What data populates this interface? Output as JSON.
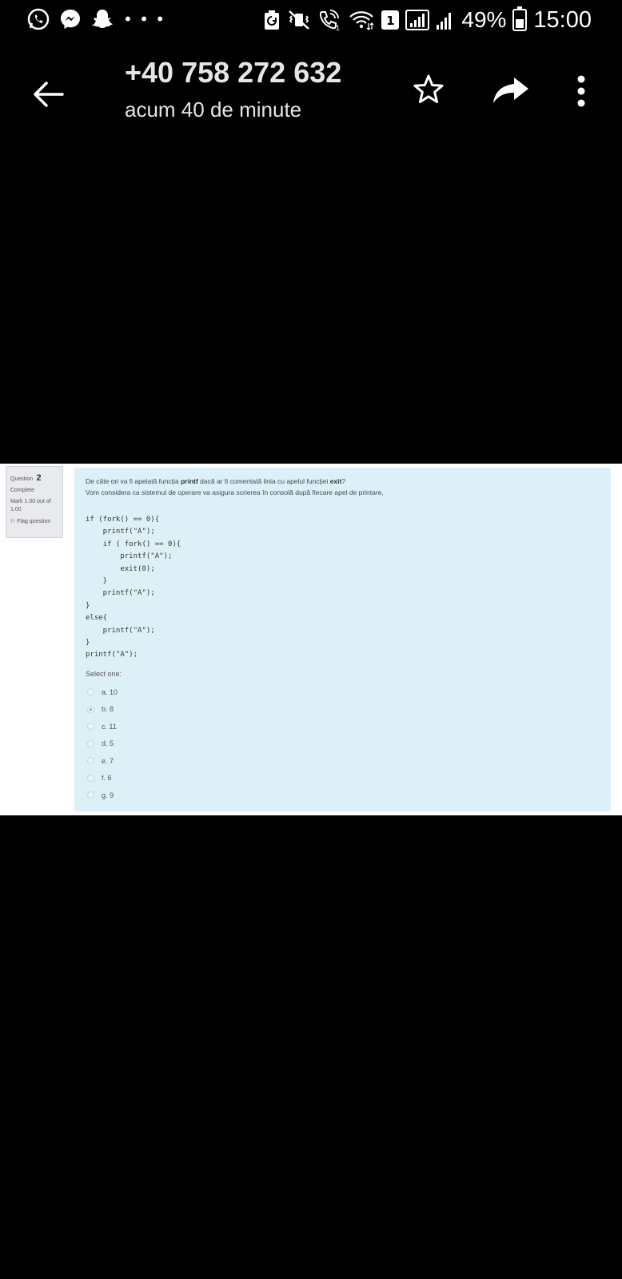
{
  "status_bar": {
    "left_icons": [
      "whatsapp-icon",
      "messenger-icon",
      "snapchat-icon"
    ],
    "more_notifications": "• • •",
    "right_icons": [
      "battery-saver-icon",
      "vibrate-mute-icon",
      "volte-call-icon",
      "wifi-icon",
      "sim-1-icon",
      "signal-icon",
      "signal-2-icon"
    ],
    "sim_label": "1",
    "battery_percent": "49%",
    "time": "15:00"
  },
  "header": {
    "contact": "+40 758 272 632",
    "subtitle": "acum 40 de minute",
    "icons": [
      "back-arrow-icon",
      "star-icon",
      "share-icon",
      "more-vert-icon"
    ]
  },
  "image": {
    "question_label": "Question",
    "question_number": "2",
    "state": "Complete",
    "mark": "Mark 1.00 out of 1.00",
    "flag": "Flag question",
    "question_line1_pre": "De câte ori va fi apelată funcția ",
    "question_line1_bold1": "printf",
    "question_line1_mid": " dacă ar fi comentată linia cu apelul funcției ",
    "question_line1_bold2": "exit",
    "question_line1_post": "?",
    "question_line2": "Vom considera ca sistemul de operare va asigura scrierea în consolă după fiecare apel de printare.",
    "code": "if (fork() == 0){\n    printf(\"A\");\n    if ( fork() == 0){\n        printf(\"A\");\n        exit(0);\n    }\n    printf(\"A\");\n}\nelse{\n    printf(\"A\");\n}\nprintf(\"A\");",
    "select_one": "Select one:",
    "options": [
      {
        "label": "a. 10",
        "checked": false
      },
      {
        "label": "b. 8",
        "checked": true
      },
      {
        "label": "c. 11",
        "checked": false
      },
      {
        "label": "d. 5",
        "checked": false
      },
      {
        "label": "e. 7",
        "checked": false
      },
      {
        "label": "f. 6",
        "checked": false
      },
      {
        "label": "g. 9",
        "checked": false
      }
    ]
  }
}
